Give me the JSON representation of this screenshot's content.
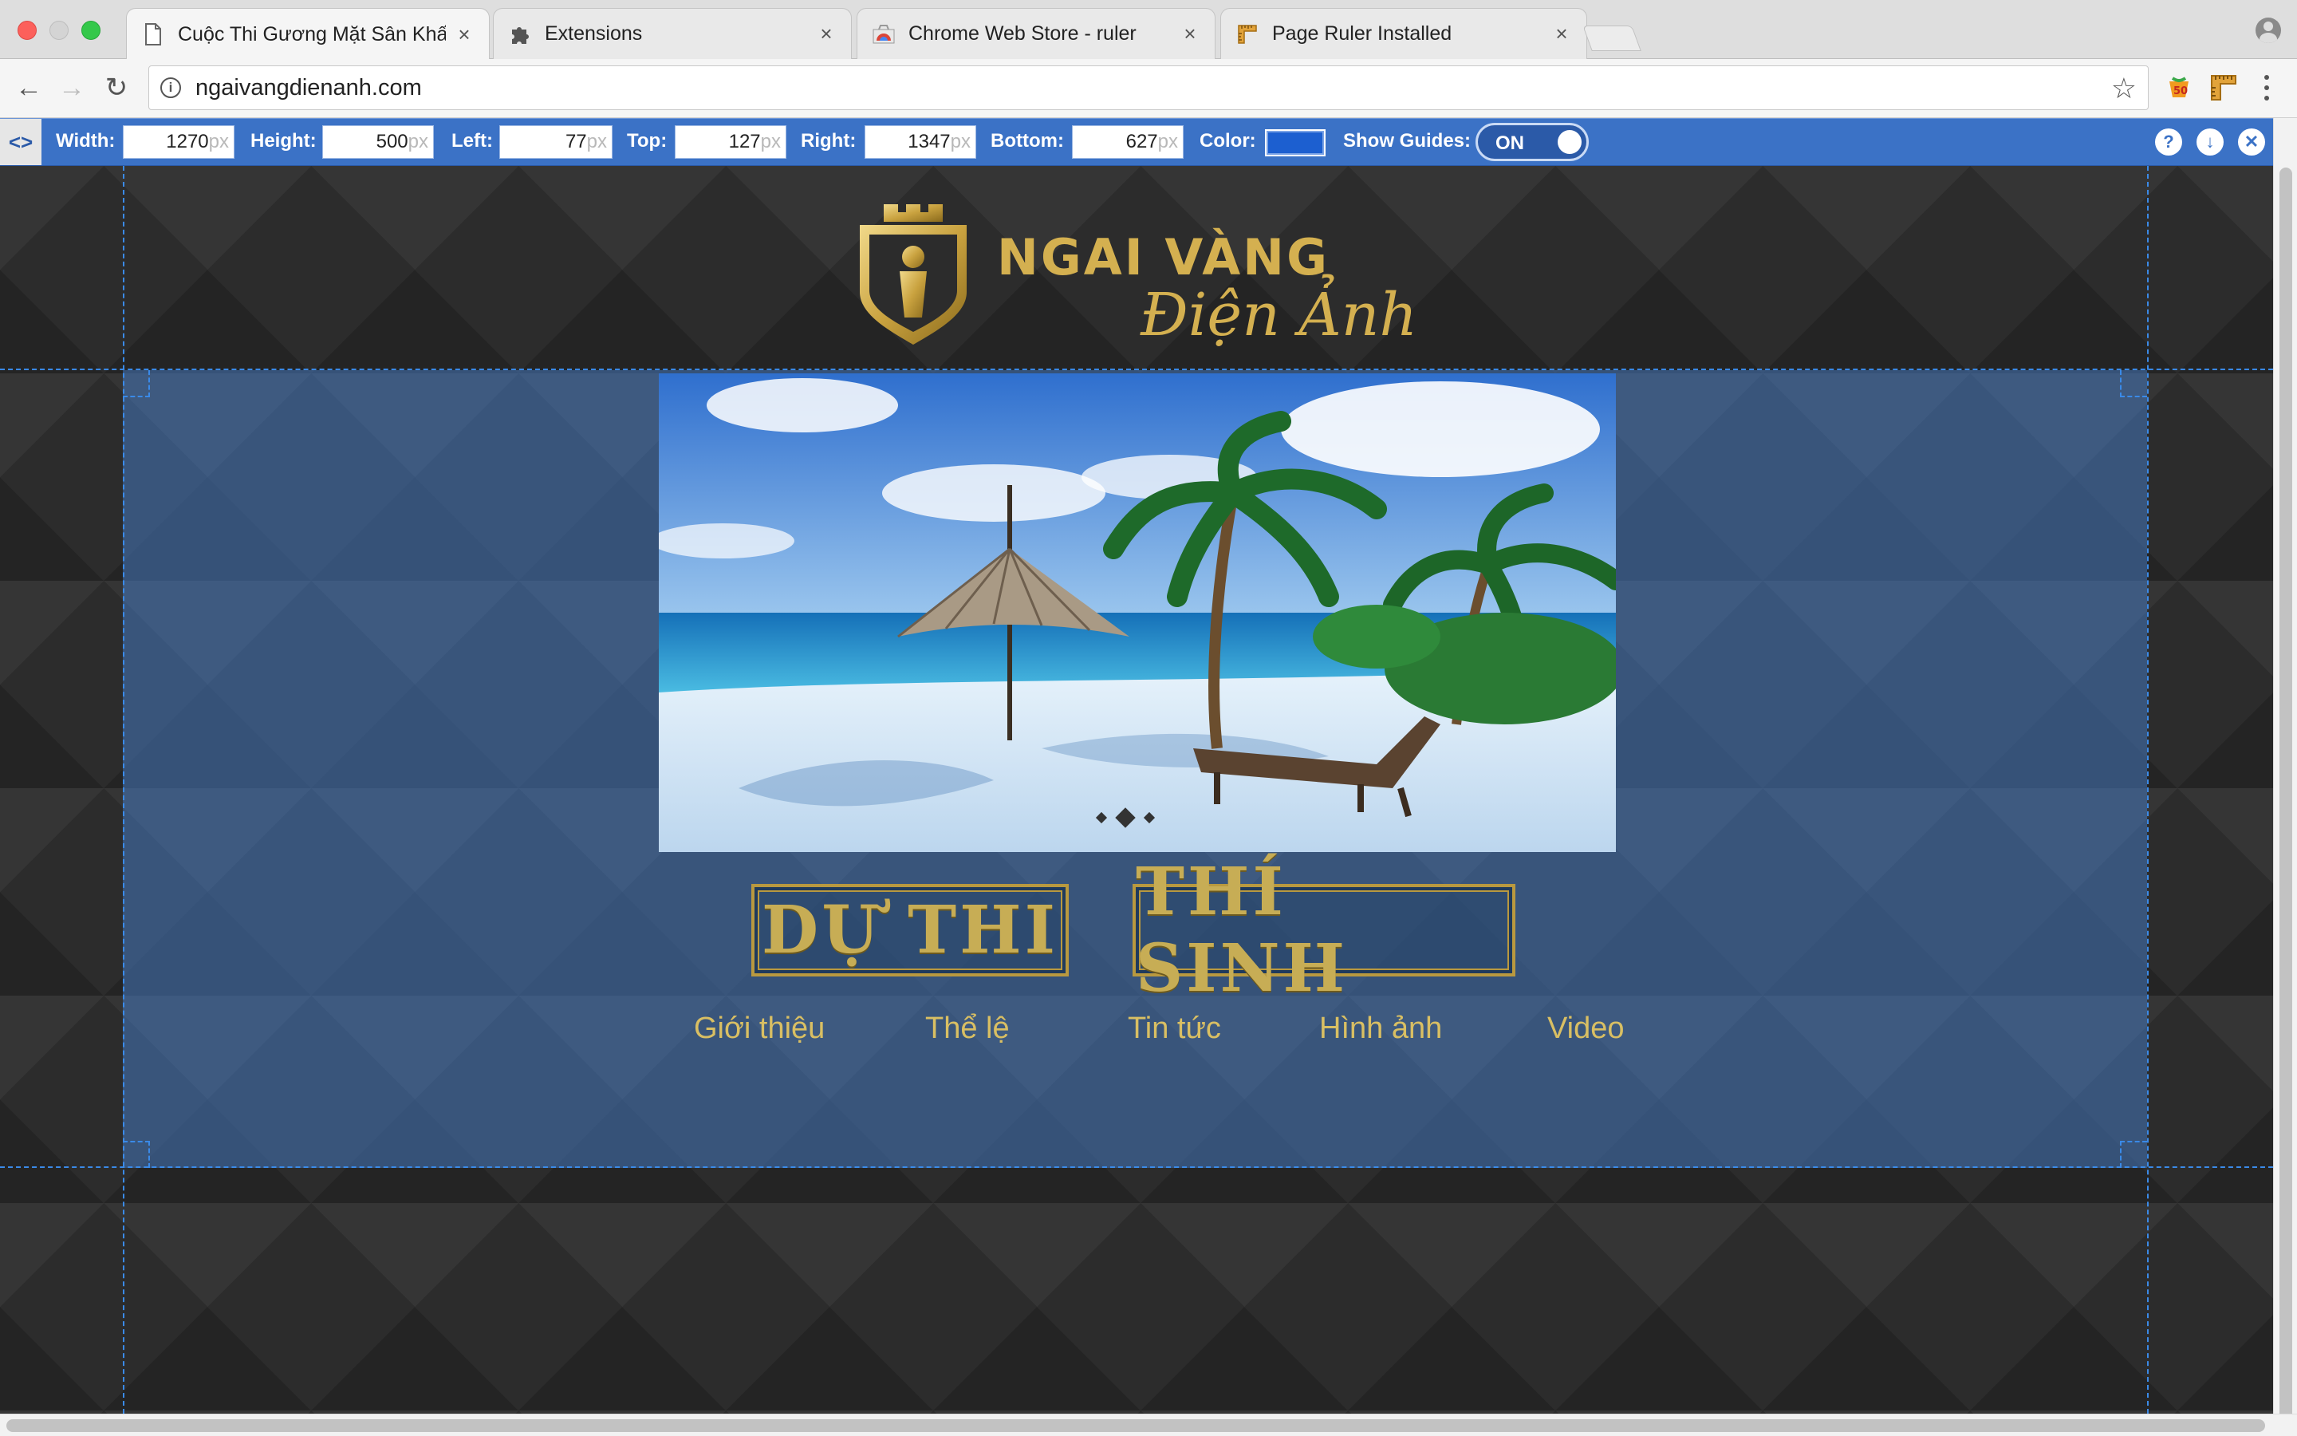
{
  "browser": {
    "tabs": [
      {
        "title": "Cuộc Thi Gương Mặt Sân Khấu",
        "icon": "page-icon",
        "active": true
      },
      {
        "title": "Extensions",
        "icon": "puzzle-icon",
        "active": false
      },
      {
        "title": "Chrome Web Store - ruler",
        "icon": "chrome-web-store-icon",
        "active": false
      },
      {
        "title": "Page Ruler Installed",
        "icon": "page-ruler-icon",
        "active": false
      }
    ],
    "tab_close_glyph": "×",
    "url": "ngaivangdienanh.com"
  },
  "page_ruler": {
    "toggle_glyph": "<>",
    "width_label": "Width:",
    "width_value": "1270",
    "height_label": "Height:",
    "height_value": "500",
    "left_label": "Left:",
    "left_value": "77",
    "top_label": "Top:",
    "top_value": "127",
    "right_label": "Right:",
    "right_value": "1347",
    "bottom_label": "Bottom:",
    "bottom_value": "627",
    "unit": "px",
    "color_label": "Color:",
    "color_value": "#1c5fd0",
    "show_guides_label": "Show Guides:",
    "show_guides_state": "ON",
    "help_glyph": "?",
    "dock_glyph": "↓",
    "close_glyph": "✕"
  },
  "site": {
    "logo_line1": "NGAI VÀNG",
    "logo_line2": "Điện Ảnh",
    "slides": {
      "count": 3,
      "active_index": 1
    },
    "cta_du_thi": "DỰ THI",
    "cta_thi_sinh": "THÍ SINH",
    "nav": [
      "Giới thiệu",
      "Thể lệ",
      "Tin tức",
      "Hình ảnh",
      "Video"
    ]
  },
  "colors": {
    "ruler_bar": "#3b72c6",
    "gold": "#d4b050",
    "overlay": "#4678be"
  }
}
